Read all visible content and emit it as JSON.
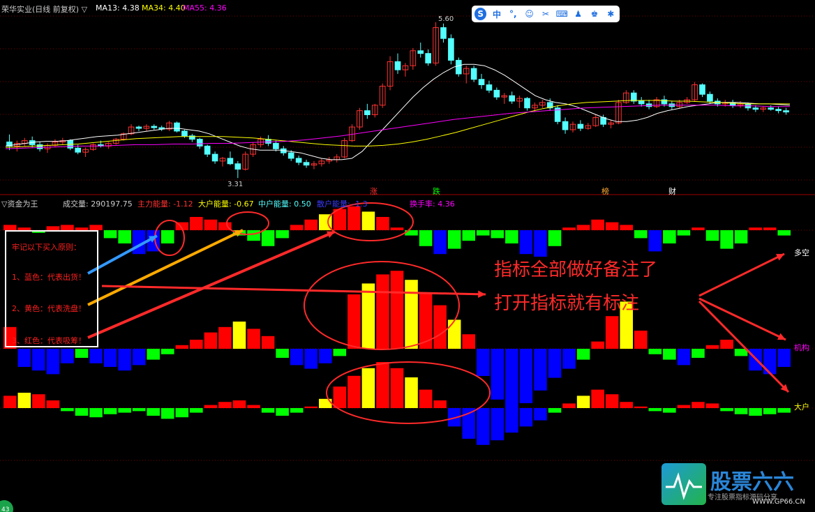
{
  "header": {
    "title": "荣华实业(日线 前复权) ▽",
    "ma13_label": "MA13: 4.38",
    "ma34_label": "MA34: 4.40",
    "ma55_label": "MA55: 4.36",
    "high_marker": "5.60",
    "low_marker": "3.31"
  },
  "toolbar": {
    "icons": [
      "logo-icon",
      "chinese-input-icon",
      "punctuation-icon",
      "emoji-icon",
      "scissors-icon",
      "keyboard-icon",
      "user-icon",
      "shirt-icon",
      "settings-icon"
    ],
    "labels": [
      "S",
      "中",
      "°,",
      "☺",
      "✂",
      "⌨",
      "♟",
      "♚",
      "✱"
    ]
  },
  "events": {
    "zhang": "涨",
    "die": "跌",
    "bang": "榜",
    "cai": "财"
  },
  "indicator": {
    "name": "▽资金为王",
    "volume": "成交量: 290197.75",
    "main_energy": "主力能量: -1.12",
    "big_energy": "大户能量: -0.67",
    "mid_energy": "中户能量: 0.50",
    "retail_energy": "散户能量: -1.3",
    "turnover": "换手率: 4.36"
  },
  "notes": {
    "heading": "牢记以下买入原则：",
    "blue": "1、蓝色：代表出货！",
    "yellow": "2、黄色：代表洗盘！",
    "red": "3、红色：代表吸筹！"
  },
  "annotation": {
    "line1": "指标全部做好备注了",
    "line2": "打开指标就有标注"
  },
  "right_labels": {
    "duokong": "多空",
    "jigou": "机构",
    "dahu": "大户"
  },
  "logo": {
    "title": "股票六六",
    "subtitle": "专注股票指标源码分享",
    "url": "WWW.GP66.CN"
  },
  "corner_badge": "43",
  "colors": {
    "up": "#ff3232",
    "down": "#54ffff",
    "ma13": "#ffffff",
    "ma34": "#ffff00",
    "ma55": "#ff00ff",
    "blue": "#0000ff",
    "yellow": "#ffff00",
    "red": "#ff0000",
    "green": "#00ff00",
    "accent": "#ff2a2a"
  },
  "chart_data": [
    {
      "type": "candlestick",
      "title": "荣华实业(日线 前复权)",
      "ylim": [
        3.2,
        5.7
      ],
      "candles": [
        [
          3.84,
          3.95,
          3.72,
          3.78
        ],
        [
          3.78,
          3.86,
          3.7,
          3.82
        ],
        [
          3.82,
          3.9,
          3.78,
          3.86
        ],
        [
          3.86,
          3.92,
          3.76,
          3.8
        ],
        [
          3.8,
          3.84,
          3.7,
          3.74
        ],
        [
          3.74,
          3.82,
          3.68,
          3.79
        ],
        [
          3.79,
          3.88,
          3.76,
          3.84
        ],
        [
          3.84,
          3.9,
          3.8,
          3.86
        ],
        [
          3.86,
          3.88,
          3.72,
          3.75
        ],
        [
          3.75,
          3.8,
          3.66,
          3.69
        ],
        [
          3.69,
          3.76,
          3.62,
          3.73
        ],
        [
          3.73,
          3.82,
          3.71,
          3.8
        ],
        [
          3.8,
          3.86,
          3.76,
          3.78
        ],
        [
          3.78,
          3.84,
          3.74,
          3.82
        ],
        [
          3.82,
          3.9,
          3.8,
          3.88
        ],
        [
          3.88,
          3.98,
          3.86,
          3.96
        ],
        [
          3.96,
          4.1,
          3.94,
          4.06
        ],
        [
          4.06,
          4.08,
          4.0,
          4.04
        ],
        [
          4.04,
          4.1,
          4.0,
          4.07
        ],
        [
          4.07,
          4.1,
          4.02,
          4.05
        ],
        [
          4.05,
          4.08,
          4.0,
          4.03
        ],
        [
          4.03,
          4.15,
          4.0,
          4.12
        ],
        [
          4.12,
          4.14,
          3.98,
          4.0
        ],
        [
          4.0,
          4.02,
          3.9,
          3.93
        ],
        [
          3.93,
          3.96,
          3.84,
          3.88
        ],
        [
          3.88,
          3.9,
          3.74,
          3.78
        ],
        [
          3.78,
          3.8,
          3.62,
          3.66
        ],
        [
          3.66,
          3.7,
          3.52,
          3.56
        ],
        [
          3.56,
          3.62,
          3.48,
          3.6
        ],
        [
          3.6,
          3.7,
          3.5,
          3.52
        ],
        [
          3.52,
          3.56,
          3.31,
          3.44
        ],
        [
          3.44,
          3.7,
          3.42,
          3.66
        ],
        [
          3.66,
          3.84,
          3.62,
          3.8
        ],
        [
          3.8,
          3.92,
          3.76,
          3.88
        ],
        [
          3.88,
          3.94,
          3.78,
          3.82
        ],
        [
          3.82,
          3.86,
          3.7,
          3.74
        ],
        [
          3.74,
          3.78,
          3.64,
          3.68
        ],
        [
          3.68,
          3.72,
          3.56,
          3.6
        ],
        [
          3.6,
          3.64,
          3.5,
          3.54
        ],
        [
          3.54,
          3.58,
          3.46,
          3.5
        ],
        [
          3.5,
          3.56,
          3.44,
          3.52
        ],
        [
          3.52,
          3.6,
          3.48,
          3.56
        ],
        [
          3.56,
          3.62,
          3.52,
          3.58
        ],
        [
          3.58,
          3.66,
          3.54,
          3.62
        ],
        [
          3.62,
          3.9,
          3.6,
          3.86
        ],
        [
          3.86,
          4.1,
          3.84,
          4.06
        ],
        [
          4.06,
          4.34,
          4.02,
          4.3
        ],
        [
          4.3,
          4.4,
          4.18,
          4.24
        ],
        [
          4.24,
          4.4,
          4.2,
          4.38
        ],
        [
          4.38,
          4.7,
          4.34,
          4.66
        ],
        [
          4.66,
          5.1,
          4.6,
          5.02
        ],
        [
          5.02,
          5.14,
          4.84,
          4.9
        ],
        [
          4.9,
          5.0,
          4.8,
          4.96
        ],
        [
          4.96,
          5.22,
          4.9,
          5.18
        ],
        [
          5.18,
          5.3,
          5.08,
          5.14
        ],
        [
          5.14,
          5.2,
          4.96,
          5.0
        ],
        [
          5.0,
          5.6,
          4.96,
          5.52
        ],
        [
          5.52,
          5.58,
          5.3,
          5.36
        ],
        [
          5.36,
          5.42,
          4.98,
          5.04
        ],
        [
          5.04,
          5.08,
          4.8,
          4.84
        ],
        [
          4.84,
          4.96,
          4.7,
          4.92
        ],
        [
          4.92,
          4.96,
          4.72,
          4.76
        ],
        [
          4.76,
          4.84,
          4.62,
          4.68
        ],
        [
          4.68,
          4.74,
          4.56,
          4.6
        ],
        [
          4.6,
          4.64,
          4.46,
          4.5
        ],
        [
          4.5,
          4.56,
          4.4,
          4.52
        ],
        [
          4.52,
          4.58,
          4.4,
          4.44
        ],
        [
          4.44,
          4.52,
          4.34,
          4.48
        ],
        [
          4.48,
          4.5,
          4.3,
          4.34
        ],
        [
          4.34,
          4.42,
          4.28,
          4.38
        ],
        [
          4.38,
          4.46,
          4.34,
          4.42
        ],
        [
          4.42,
          4.48,
          4.3,
          4.34
        ],
        [
          4.34,
          4.38,
          4.1,
          4.14
        ],
        [
          4.14,
          4.2,
          3.96,
          4.02
        ],
        [
          4.02,
          4.14,
          3.98,
          4.1
        ],
        [
          4.1,
          4.16,
          4.0,
          4.04
        ],
        [
          4.04,
          4.12,
          4.02,
          4.08
        ],
        [
          4.08,
          4.24,
          4.06,
          4.2
        ],
        [
          4.2,
          4.24,
          4.06,
          4.1
        ],
        [
          4.1,
          4.16,
          4.04,
          4.12
        ],
        [
          4.12,
          4.46,
          4.1,
          4.42
        ],
        [
          4.42,
          4.6,
          4.4,
          4.56
        ],
        [
          4.56,
          4.6,
          4.4,
          4.44
        ],
        [
          4.44,
          4.5,
          4.36,
          4.4
        ],
        [
          4.4,
          4.46,
          4.32,
          4.36
        ],
        [
          4.36,
          4.5,
          4.34,
          4.46
        ],
        [
          4.46,
          4.52,
          4.36,
          4.4
        ],
        [
          4.4,
          4.44,
          4.32,
          4.36
        ],
        [
          4.36,
          4.46,
          4.34,
          4.42
        ],
        [
          4.42,
          4.5,
          4.4,
          4.46
        ],
        [
          4.46,
          4.72,
          4.44,
          4.68
        ],
        [
          4.68,
          4.7,
          4.5,
          4.54
        ],
        [
          4.54,
          4.58,
          4.4,
          4.44
        ],
        [
          4.44,
          4.48,
          4.36,
          4.4
        ],
        [
          4.4,
          4.46,
          4.36,
          4.42
        ],
        [
          4.42,
          4.46,
          4.34,
          4.38
        ],
        [
          4.38,
          4.44,
          4.34,
          4.4
        ],
        [
          4.4,
          4.42,
          4.3,
          4.34
        ],
        [
          4.34,
          4.38,
          4.28,
          4.32
        ],
        [
          4.32,
          4.36,
          4.28,
          4.34
        ],
        [
          4.34,
          4.38,
          4.3,
          4.32
        ],
        [
          4.32,
          4.36,
          4.26,
          4.3
        ],
        [
          4.3,
          4.34,
          4.24,
          4.28
        ]
      ],
      "ma13": [
        3.78,
        3.8,
        3.82,
        3.84,
        3.85,
        3.85,
        3.86,
        3.88,
        3.9,
        3.92,
        3.93,
        3.94,
        3.96,
        3.98,
        4.0,
        4.02,
        4.04,
        4.04,
        4.02,
        4.0,
        3.96,
        3.9,
        3.84,
        3.78,
        3.74,
        3.72,
        3.72,
        3.72,
        3.7,
        3.68,
        3.64,
        3.6,
        3.58,
        3.58,
        3.6,
        3.7,
        3.86,
        4.02,
        4.18,
        4.34,
        4.5,
        4.64,
        4.76,
        4.86,
        4.94,
        4.98,
        4.98,
        4.96,
        4.9,
        4.82,
        4.72,
        4.62,
        4.52,
        4.46,
        4.42,
        4.4,
        4.36,
        4.3,
        4.24,
        4.18,
        4.14,
        4.14,
        4.16,
        4.2,
        4.26,
        4.3,
        4.33,
        4.36,
        4.38,
        4.4,
        4.42,
        4.42,
        4.42,
        4.41,
        4.4,
        4.4,
        4.39,
        4.38
      ],
      "ma34": [
        3.76,
        3.77,
        3.78,
        3.79,
        3.8,
        3.81,
        3.83,
        3.85,
        3.87,
        3.89,
        3.9,
        3.91,
        3.92,
        3.92,
        3.92,
        3.92,
        3.91,
        3.9,
        3.88,
        3.86,
        3.84,
        3.82,
        3.8,
        3.79,
        3.78,
        3.78,
        3.79,
        3.81,
        3.84,
        3.88,
        3.93,
        3.98,
        4.04,
        4.1,
        4.16,
        4.22,
        4.28,
        4.33,
        4.37,
        4.4,
        4.42,
        4.43,
        4.44,
        4.45,
        4.45,
        4.45,
        4.44,
        4.44,
        4.43,
        4.42,
        4.41,
        4.4,
        4.4,
        4.4,
        4.4
      ],
      "ma55": [
        3.74,
        3.75,
        3.76,
        3.77,
        3.78,
        3.78,
        3.79,
        3.8,
        3.8,
        3.81,
        3.81,
        3.82,
        3.82,
        3.83,
        3.84,
        3.85,
        3.87,
        3.9,
        3.93,
        3.97,
        4.01,
        4.05,
        4.09,
        4.13,
        4.17,
        4.2,
        4.23,
        4.26,
        4.28,
        4.3,
        4.32,
        4.34,
        4.35,
        4.36,
        4.37,
        4.38,
        4.38,
        4.38,
        4.38,
        4.37,
        4.37,
        4.36,
        4.36
      ]
    },
    {
      "type": "bar",
      "title": "资金为王",
      "series": [
        {
          "name": "多空",
          "values": [
            0.2,
            0.1,
            -0.1,
            0.15,
            0.2,
            0.1,
            0.2,
            -0.3,
            -0.5,
            -0.9,
            -0.8,
            -0.5,
            0.3,
            0.5,
            0.4,
            0.3,
            -0.2,
            -0.4,
            -0.6,
            -0.3,
            0.2,
            0.4,
            0.6,
            0.8,
            0.9,
            0.7,
            0.5,
            0.1,
            -0.2,
            -0.6,
            -0.9,
            -0.7,
            -0.4,
            -0.2,
            -0.3,
            -0.5,
            -0.9,
            -1.0,
            -0.6,
            0.1,
            0.2,
            0.4,
            0.3,
            0.2,
            -0.3,
            -0.8,
            -0.5,
            -0.2,
            0.1,
            -0.4,
            -0.7,
            -0.5,
            0.1,
            0.1,
            -0.2
          ]
        },
        {
          "name": "机构",
          "values": [
            1.2,
            -1.0,
            -1.2,
            -1.4,
            -0.8,
            -0.5,
            -0.8,
            -1.0,
            -1.2,
            -0.9,
            -0.6,
            -0.3,
            0.2,
            0.5,
            0.9,
            1.2,
            1.5,
            1.1,
            0.7,
            -0.5,
            -0.9,
            -1.1,
            -0.8,
            -0.4,
            3.0,
            3.6,
            4.1,
            4.3,
            3.8,
            3.1,
            2.4,
            1.6,
            0.8,
            -1.5,
            -2.8,
            -3.4,
            -3.0,
            -2.3,
            -1.6,
            -1.1,
            -0.6,
            0.4,
            1.8,
            2.6,
            1.0,
            -0.3,
            -0.6,
            -0.9,
            -0.5,
            0.2,
            0.5,
            -0.4,
            -1.2,
            -1.4,
            -1.0
          ]
        },
        {
          "name": "大户",
          "values": [
            0.8,
            1.0,
            0.9,
            0.5,
            -0.2,
            -0.5,
            -0.6,
            -0.4,
            -0.3,
            -0.2,
            -0.5,
            -0.7,
            -0.6,
            -0.3,
            0.2,
            0.4,
            0.5,
            0.2,
            -0.3,
            -0.5,
            -0.3,
            0.1,
            0.6,
            1.4,
            2.1,
            2.6,
            3.0,
            2.6,
            2.0,
            1.2,
            0.5,
            -1.2,
            -2.0,
            -2.4,
            -2.1,
            -1.6,
            -1.2,
            -0.8,
            -0.3,
            0.3,
            0.8,
            1.2,
            0.9,
            0.4,
            0.1,
            -0.2,
            -0.3,
            0.2,
            0.4,
            0.3,
            -0.2,
            -0.4,
            -0.5,
            -0.4,
            -0.3
          ]
        }
      ]
    }
  ]
}
